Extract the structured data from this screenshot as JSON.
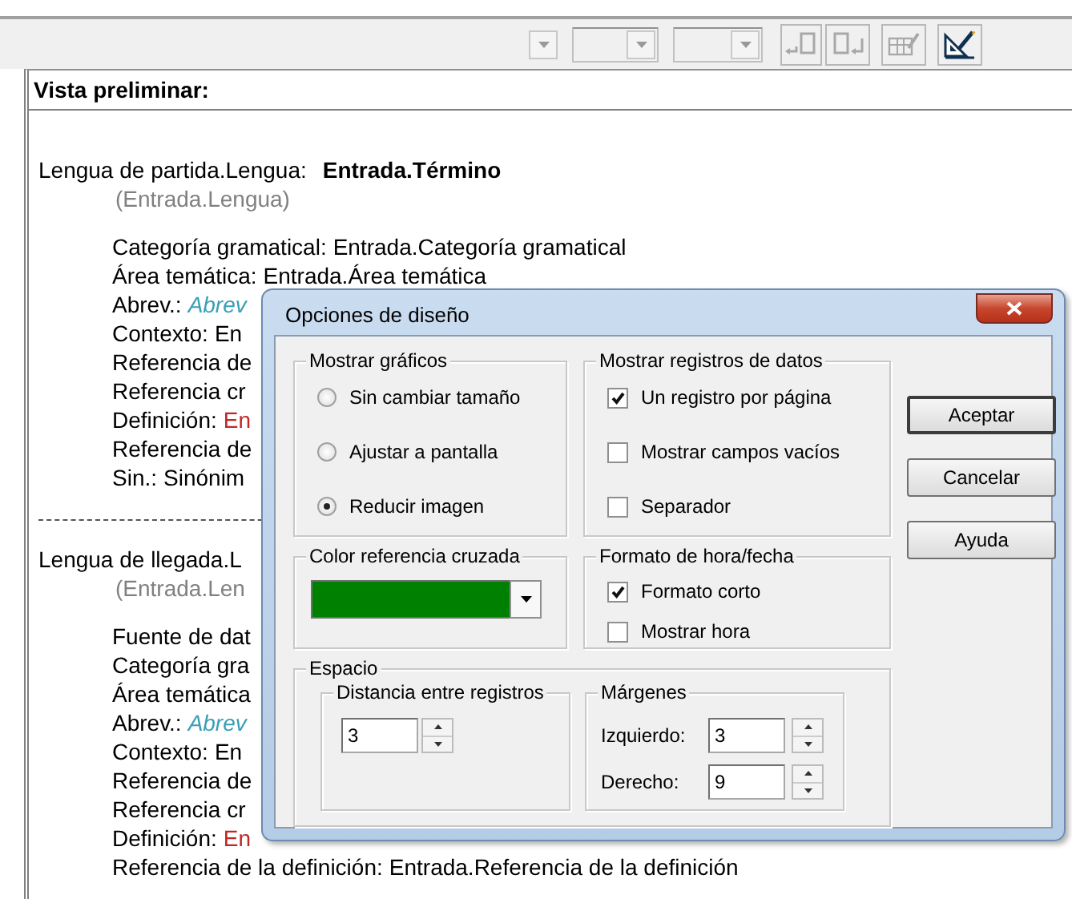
{
  "toolbar": {
    "buttons": [
      {
        "kind": "page-back",
        "disabled": true
      },
      {
        "kind": "page-forward",
        "disabled": true
      },
      {
        "kind": "edit-table",
        "disabled": true
      },
      {
        "kind": "layout",
        "disabled": false
      }
    ]
  },
  "preview": {
    "title": "Vista preliminar:",
    "lines": [
      {
        "kind": "term",
        "label": "Lengua de partida.Lengua:",
        "term": "Entrada.Término"
      },
      {
        "kind": "lang",
        "text": "(Entrada.Lengua)"
      },
      {
        "kind": "field",
        "label": "Categoría gramatical:",
        "value": "Entrada.Categoría gramatical"
      },
      {
        "kind": "field",
        "label": "Área temática:",
        "value": "Entrada.Área temática"
      },
      {
        "kind": "field",
        "label": "Abrev.:",
        "value": "Abrev",
        "color": "#3a9fb5",
        "italic": true
      },
      {
        "kind": "field",
        "label": "Contexto:",
        "value": "En"
      },
      {
        "kind": "field",
        "label": "Referencia de"
      },
      {
        "kind": "field",
        "label": "Referencia cr"
      },
      {
        "kind": "field",
        "label": "Definición:",
        "value": "En",
        "color": "#c02828"
      },
      {
        "kind": "field",
        "label": "Referencia de"
      },
      {
        "kind": "field",
        "label": "Sin.:",
        "value": "Sinónim"
      },
      {
        "kind": "separator"
      },
      {
        "kind": "term",
        "label": "Lengua de llegada.L"
      },
      {
        "kind": "lang",
        "text": "(Entrada.Len"
      },
      {
        "kind": "field",
        "label": "Fuente de dat"
      },
      {
        "kind": "field",
        "label": "Categoría gra"
      },
      {
        "kind": "field",
        "label": "Área temática"
      },
      {
        "kind": "field",
        "label": "Abrev.:",
        "value": "Abrev",
        "color": "#3a9fb5",
        "italic": true
      },
      {
        "kind": "field",
        "label": "Contexto:",
        "value": "En"
      },
      {
        "kind": "field",
        "label": "Referencia de"
      },
      {
        "kind": "field",
        "label": "Referencia cr"
      },
      {
        "kind": "field",
        "label": "Definición:",
        "value": "En",
        "color": "#c02828"
      },
      {
        "kind": "field",
        "label": "Referencia de la definición:",
        "value": "Entrada.Referencia de la definición"
      }
    ]
  },
  "dialog": {
    "title": "Opciones de diseño",
    "mostrar_graficos": {
      "label": "Mostrar gráficos",
      "options": [
        {
          "label": "Sin cambiar tamaño",
          "selected": false
        },
        {
          "label": "Ajustar a pantalla",
          "selected": false
        },
        {
          "label": "Reducir imagen",
          "selected": true
        }
      ]
    },
    "mostrar_registros": {
      "label": "Mostrar registros de datos",
      "options": [
        {
          "label": "Un registro por página",
          "checked": true
        },
        {
          "label": "Mostrar campos vacíos",
          "checked": false
        },
        {
          "label": "Separador",
          "checked": false
        }
      ]
    },
    "color_referencia": {
      "label": "Color referencia cruzada",
      "color": "#008000"
    },
    "formato": {
      "label": "Formato de hora/fecha",
      "options": [
        {
          "label": "Formato corto",
          "checked": true
        },
        {
          "label": "Mostrar hora",
          "checked": false
        }
      ]
    },
    "espacio": {
      "label": "Espacio",
      "distancia": {
        "label": "Distancia entre registros",
        "value": "3"
      },
      "margenes": {
        "label": "Márgenes",
        "fields": [
          {
            "label": "Izquierdo:",
            "value": "3"
          },
          {
            "label": "Derecho:",
            "value": "9"
          }
        ]
      }
    },
    "buttons": [
      {
        "label": "Aceptar",
        "default": true
      },
      {
        "label": "Cancelar",
        "default": false
      },
      {
        "label": "Ayuda",
        "default": false
      }
    ]
  }
}
